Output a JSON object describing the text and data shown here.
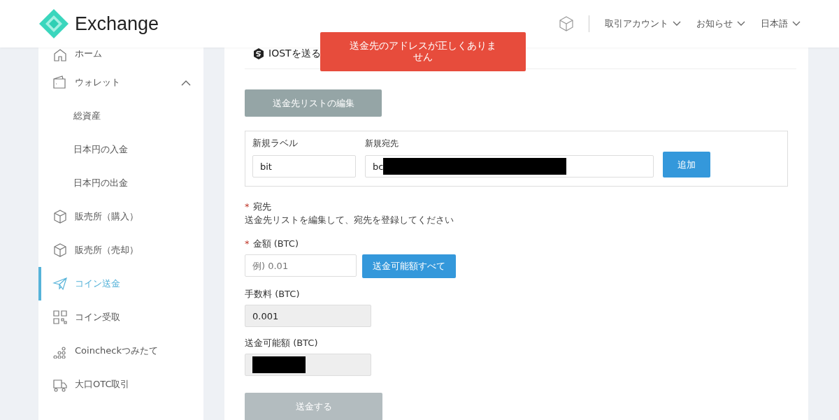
{
  "header": {
    "logo_text": "Exchange",
    "nav": [
      {
        "label": "取引アカウント"
      },
      {
        "label": "お知らせ"
      },
      {
        "label": "日本語"
      }
    ]
  },
  "toast": {
    "message": "送金先のアドレスが正しくありません"
  },
  "sidebar": {
    "items": [
      {
        "label": "ホーム",
        "selected": false
      },
      {
        "label": "ウォレット",
        "selected": false,
        "expanded": true,
        "children": [
          {
            "label": "総資産",
            "selected": false
          },
          {
            "label": "日本円の入金",
            "selected": false
          },
          {
            "label": "日本円の出金",
            "selected": false
          }
        ]
      },
      {
        "label": "販売所（購入）",
        "selected": false
      },
      {
        "label": "販売所（売却）",
        "selected": false
      },
      {
        "label": "コイン送金",
        "selected": true
      },
      {
        "label": "コイン受取",
        "selected": false
      },
      {
        "label": "Coincheckつみたて",
        "selected": false
      },
      {
        "label": "大口OTC取引",
        "selected": false
      }
    ]
  },
  "form": {
    "title": "IOSTを送る",
    "edit_button": "送金先リストの編集",
    "new_label": {
      "label": "新規ラベル",
      "value": "bit"
    },
    "new_address": {
      "label": "新規宛先",
      "value": "bc"
    },
    "add_button": "追加",
    "destination": {
      "label": "宛先",
      "required": true,
      "required_mark": "*",
      "hint": "送金先リストを編集して、宛先を登録してください"
    },
    "amount": {
      "label": "金額 (BTC)",
      "required": true,
      "required_mark": "*",
      "placeholder": "例) 0.01",
      "button": "送金可能額すべて"
    },
    "fee": {
      "label": "手数料 (BTC)",
      "value": "0.001"
    },
    "available": {
      "label": "送金可能額 (BTC)"
    },
    "send_button": {
      "label": "送金する",
      "disabled": true
    }
  }
}
